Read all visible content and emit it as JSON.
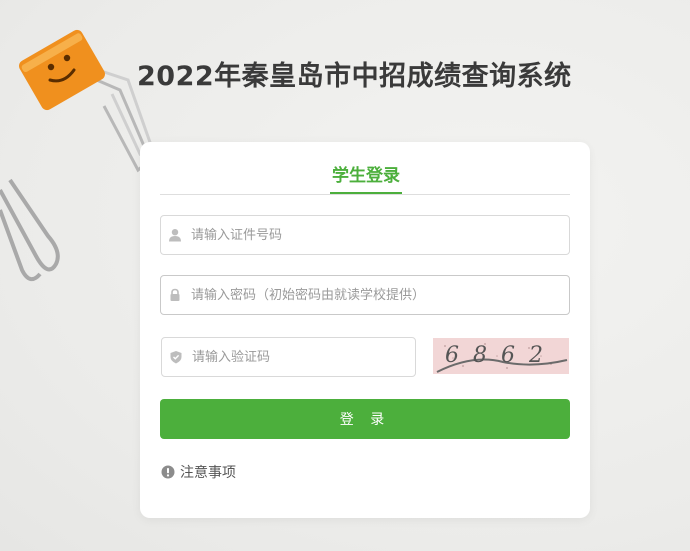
{
  "page": {
    "title": "2022年秦皇岛市中招成绩查询系统"
  },
  "login_card": {
    "tab_label": "学生登录",
    "id_field": {
      "placeholder": "请输入证件号码",
      "icon": "user-icon"
    },
    "password_field": {
      "placeholder": "请输入密码（初始密码由就读学校提供）",
      "icon": "lock-icon"
    },
    "captcha_field": {
      "placeholder": "请输入验证码",
      "icon": "shield-icon"
    },
    "captcha_text": "6862",
    "login_button": "登 录",
    "notice_link": "注意事项",
    "notice_icon": "exclamation-circle-icon"
  },
  "colors": {
    "accent": "#4caf3c",
    "title": "#3a3a3a",
    "clip_orange": "#f0901e"
  }
}
